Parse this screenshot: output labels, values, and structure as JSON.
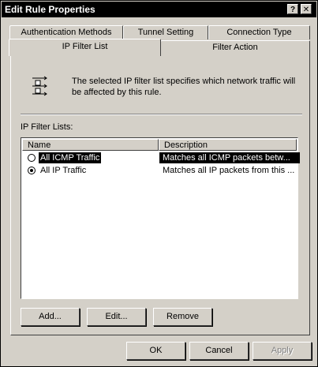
{
  "window": {
    "title": "Edit Rule Properties",
    "help_btn": "?",
    "close_btn": "✕"
  },
  "tabs": {
    "back_row": [
      "Authentication Methods",
      "Tunnel Setting",
      "Connection Type"
    ],
    "front_row": [
      {
        "label": "IP Filter List",
        "selected": true
      },
      {
        "label": "Filter Action",
        "selected": false
      }
    ]
  },
  "panel": {
    "hint": "The selected IP filter list specifies which network traffic will be affected by this rule.",
    "list_label": "IP Filter Lists:",
    "columns": [
      "Name",
      "Description"
    ],
    "rows": [
      {
        "name": "All ICMP Traffic",
        "description": "Matches all ICMP packets betw...",
        "checked": false,
        "highlighted": true
      },
      {
        "name": "All IP Traffic",
        "description": "Matches all IP packets from this ...",
        "checked": true,
        "highlighted": false
      }
    ],
    "buttons": {
      "add": "Add...",
      "edit": "Edit...",
      "remove": "Remove"
    }
  },
  "footer": {
    "ok": "OK",
    "cancel": "Cancel",
    "apply": "Apply"
  },
  "colors": {
    "face": "#d4d0c8",
    "titlebar": "#000000",
    "highlight": "#000000"
  }
}
